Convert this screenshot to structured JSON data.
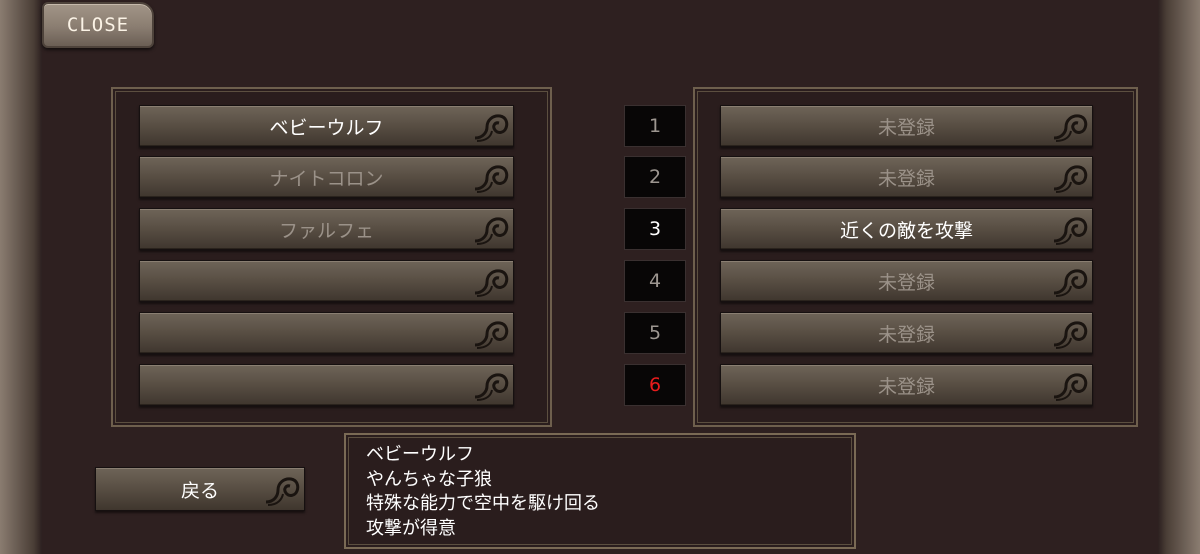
{
  "close_label": "CLOSE",
  "left_slots": [
    {
      "label": "ベビーウルフ",
      "state": "lit"
    },
    {
      "label": "ナイトコロン",
      "state": "dim"
    },
    {
      "label": "ファルフェ",
      "state": "dim"
    },
    {
      "label": "",
      "state": "dim"
    },
    {
      "label": "",
      "state": "dim"
    },
    {
      "label": "",
      "state": "dim"
    }
  ],
  "numbers": [
    {
      "label": "1",
      "state": "dim"
    },
    {
      "label": "2",
      "state": "dim"
    },
    {
      "label": "3",
      "state": "lit"
    },
    {
      "label": "4",
      "state": "dim"
    },
    {
      "label": "5",
      "state": "dim"
    },
    {
      "label": "6",
      "state": "red"
    }
  ],
  "right_slots": [
    {
      "label": "未登録",
      "state": "dim"
    },
    {
      "label": "未登録",
      "state": "dim"
    },
    {
      "label": "近くの敵を攻撃",
      "state": "lit"
    },
    {
      "label": "未登録",
      "state": "dim"
    },
    {
      "label": "未登録",
      "state": "dim"
    },
    {
      "label": "未登録",
      "state": "dim"
    }
  ],
  "back_label": "戻る",
  "description": {
    "lines": [
      "ベビーウルフ",
      "やんちゃな子狼",
      "特殊な能力で空中を駆け回る",
      "攻撃が得意"
    ]
  },
  "colors": {
    "background": "#2c1f1f",
    "text_lit": "#ffffff",
    "text_dim": "#9b9289",
    "number_red": "#e81c1c"
  }
}
